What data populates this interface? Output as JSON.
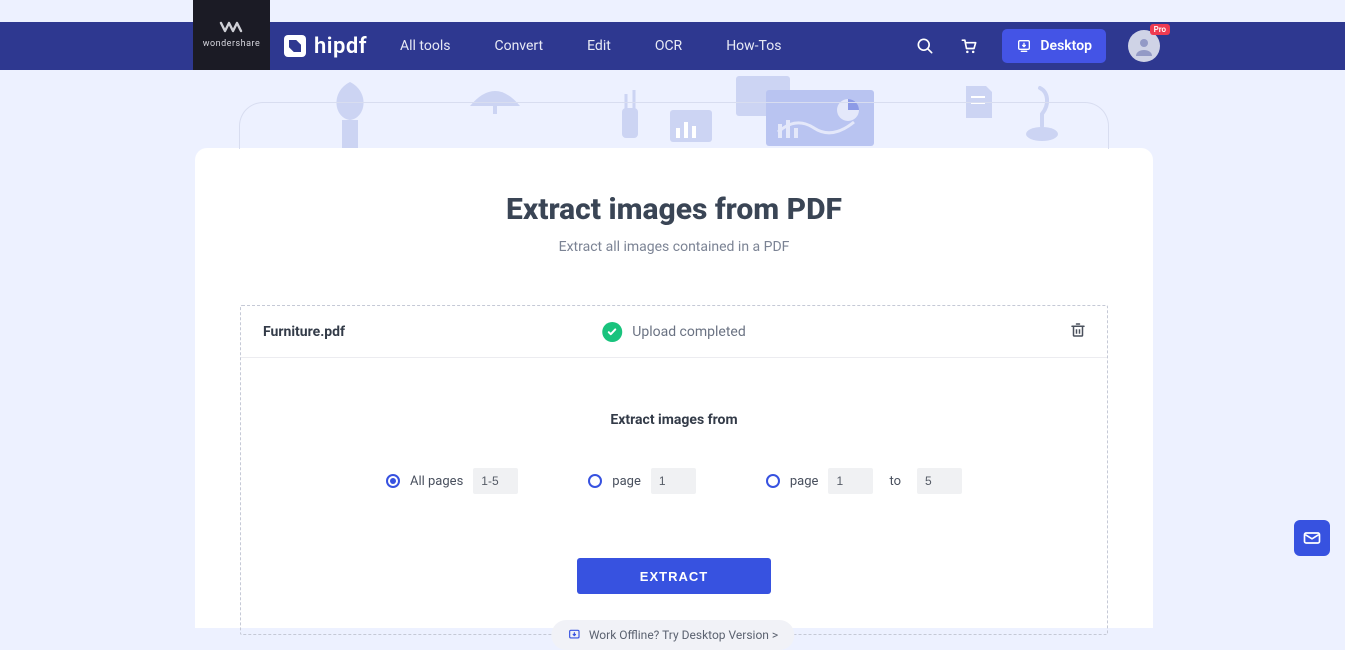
{
  "brand": {
    "company": "wondershare",
    "product": "hipdf"
  },
  "nav": {
    "items": [
      "All tools",
      "Convert",
      "Edit",
      "OCR",
      "How-Tos"
    ],
    "desktop_label": "Desktop",
    "avatar_badge": "Pro"
  },
  "page": {
    "title": "Extract images from PDF",
    "subtitle": "Extract all images contained in a PDF"
  },
  "file": {
    "name": "Furniture.pdf",
    "status": "Upload completed"
  },
  "options": {
    "section_title": "Extract images from",
    "all_pages_label": "All pages",
    "all_pages_value": "1-5",
    "single_label": "page",
    "single_value": "1",
    "range_label": "page",
    "range_from": "1",
    "range_to_label": "to",
    "range_to": "5"
  },
  "actions": {
    "extract_label": "EXTRACT",
    "offline_label": "Work Offline? Try Desktop Version >"
  }
}
